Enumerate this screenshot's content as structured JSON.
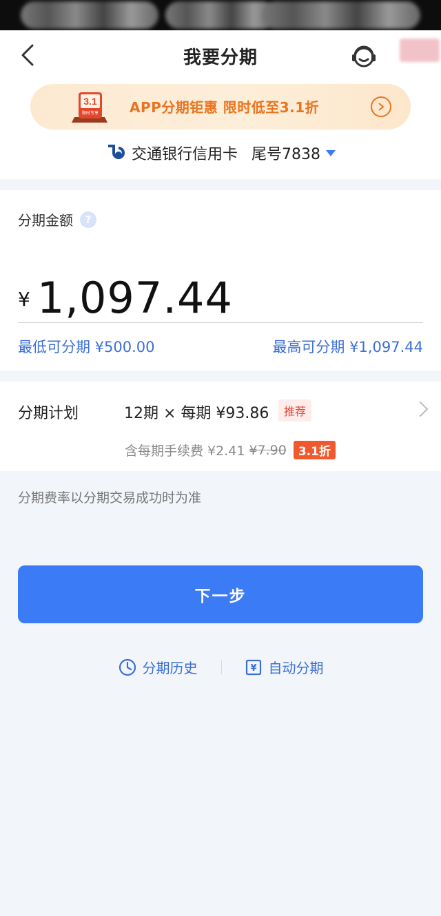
{
  "nav": {
    "title": "我要分期"
  },
  "promo": {
    "badge_value": "3.1",
    "badge_sub": "限时专享",
    "text": "APP分期钜惠 限时低至3.1折"
  },
  "card": {
    "bank_name": "交通银行信用卡",
    "tail": "尾号7838"
  },
  "amount": {
    "label": "分期金额",
    "help": "?",
    "currency": "¥",
    "value": "1,097.44",
    "min_label": "最低可分期 ¥500.00",
    "max_label": "最高可分期 ¥1,097.44"
  },
  "plan": {
    "label": "分期计划",
    "value": "12期 × 每期 ¥93.86",
    "tag": "推荐",
    "fee_text": "含每期手续费 ¥2.41",
    "fee_original": "¥7.90",
    "discount": "3.1折"
  },
  "note": "分期费率以分期交易成功时为准",
  "next_button": "下一步",
  "links": {
    "history": "分期历史",
    "auto": "自动分期"
  },
  "colors": {
    "primary": "#3b7bf6",
    "promo_orange": "#e8741f",
    "discount_red": "#f0582e"
  }
}
